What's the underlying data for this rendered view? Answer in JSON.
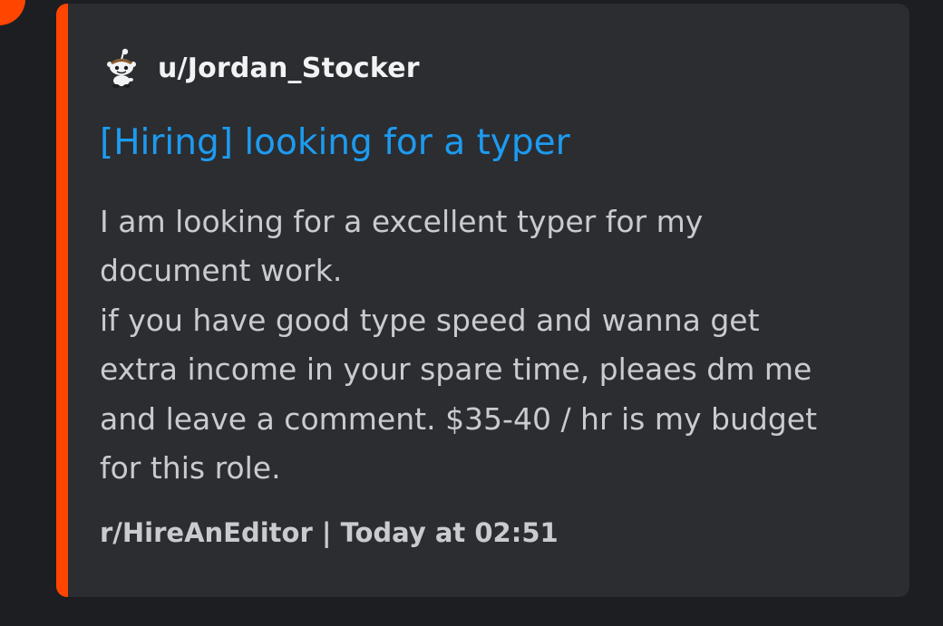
{
  "embed": {
    "accent_color": "#ff4500",
    "author": {
      "icon": "reddit-snoo-icon",
      "name": "u/Jordan_Stocker"
    },
    "title": "[Hiring] looking for a typer",
    "title_color": "#1d9bf0",
    "body_lines": [
      "I am looking for a excellent typer for my",
      "document work.",
      "if you have good type speed and wanna get",
      "extra income in your spare time, pleaes dm me",
      "and leave a comment. $35-40 / hr is my budget",
      "for this role."
    ],
    "footer": {
      "subreddit": "r/HireAnEditor",
      "separator": " | ",
      "timestamp": "Today at 02:51"
    }
  },
  "corner_avatar_color": "#ff4500"
}
